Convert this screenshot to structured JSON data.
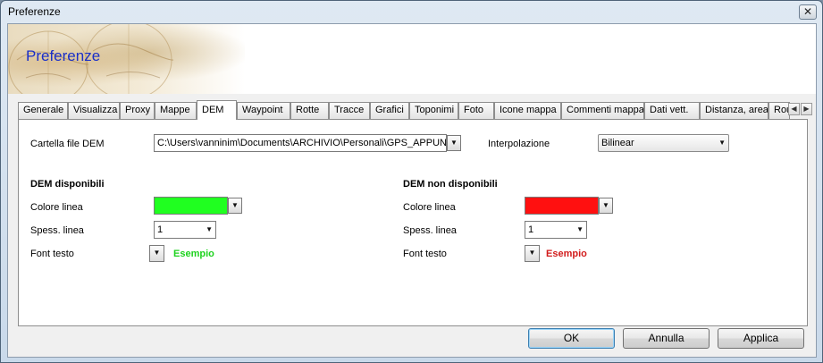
{
  "window": {
    "title": "Preferenze",
    "close_glyph": "✕"
  },
  "banner": {
    "title": "Preferenze"
  },
  "tabs": [
    {
      "label": "Generale"
    },
    {
      "label": "Visualizza"
    },
    {
      "label": "Proxy"
    },
    {
      "label": "Mappe"
    },
    {
      "label": "DEM",
      "active": true
    },
    {
      "label": "Waypoint"
    },
    {
      "label": "Rotte"
    },
    {
      "label": "Tracce"
    },
    {
      "label": "Grafici"
    },
    {
      "label": "Toponimi"
    },
    {
      "label": "Foto"
    },
    {
      "label": "Icone mappa"
    },
    {
      "label": "Commenti mappa"
    },
    {
      "label": "Dati vett."
    },
    {
      "label": "Distanza, area"
    },
    {
      "label": "Rou"
    }
  ],
  "dem": {
    "folder_label": "Cartella file DEM",
    "folder_value": "C:\\Users\\vanninim\\Documents\\ARCHIVIO\\Personali\\GPS_APPUN",
    "interpolation_label": "Interpolazione",
    "interpolation_value": "Bilinear",
    "available": {
      "header": "DEM disponibili",
      "line_color_label": "Colore linea",
      "line_color": "#20ff20",
      "line_width_label": "Spess. linea",
      "line_width_value": "1",
      "font_label": "Font testo",
      "example_text": "Esempio",
      "example_color": "#1ed21e"
    },
    "unavailable": {
      "header": "DEM non disponibili",
      "line_color_label": "Colore linea",
      "line_color": "#ff1010",
      "line_width_label": "Spess. linea",
      "line_width_value": "1",
      "font_label": "Font testo",
      "example_text": "Esempio",
      "example_color": "#d21c1c"
    }
  },
  "buttons": {
    "ok": "OK",
    "cancel": "Annulla",
    "apply": "Applica"
  },
  "icons": {
    "dropdown": "▼",
    "scroll_left": "◀",
    "scroll_right": "▶"
  }
}
